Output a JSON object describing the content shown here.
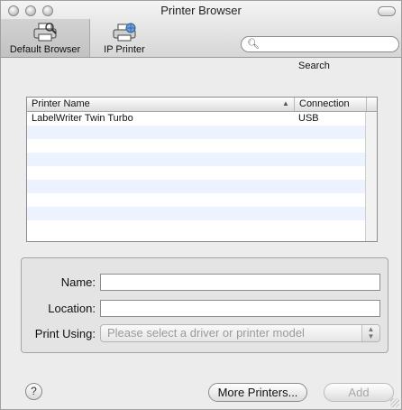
{
  "window": {
    "title": "Printer Browser"
  },
  "toolbar": {
    "default_browser_label": "Default Browser",
    "ip_printer_label": "IP Printer",
    "search_label": "Search",
    "search_value": ""
  },
  "table": {
    "columns": [
      "Printer Name",
      "Connection"
    ],
    "rows": [
      {
        "name": "LabelWriter Twin Turbo",
        "connection": "USB"
      }
    ]
  },
  "form": {
    "name_label": "Name:",
    "name_value": "",
    "location_label": "Location:",
    "location_value": "",
    "print_using_label": "Print Using:",
    "print_using_value": "Please select a driver or printer model"
  },
  "buttons": {
    "help_glyph": "?",
    "more_printers": "More Printers...",
    "add": "Add"
  }
}
